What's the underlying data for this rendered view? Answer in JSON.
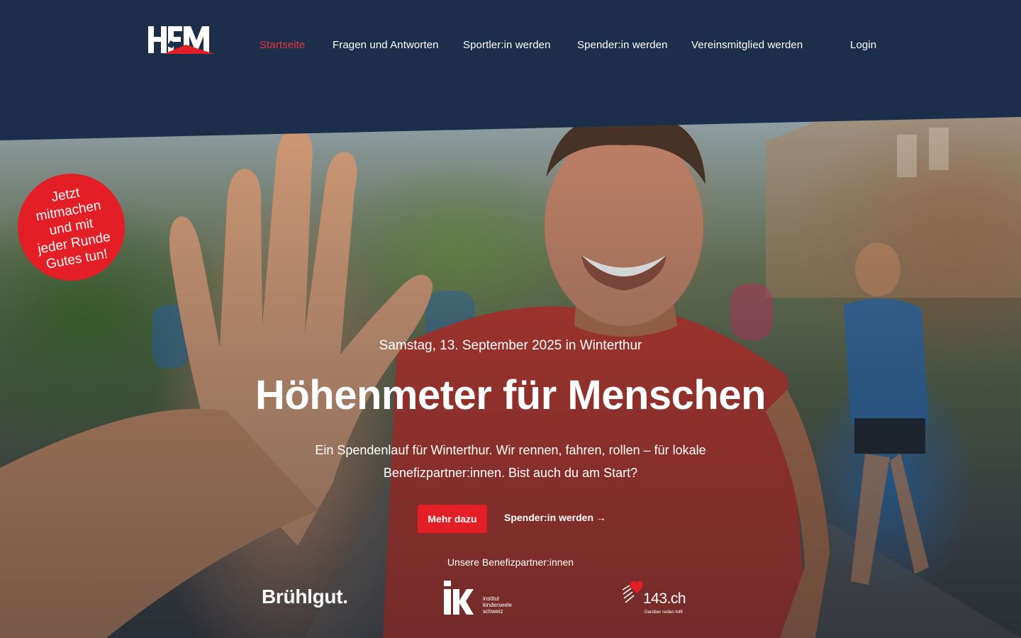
{
  "header": {
    "logo_text": "HfM",
    "nav": [
      {
        "label": "Startseite",
        "active": true
      },
      {
        "label": "Fragen und Antworten",
        "active": false
      },
      {
        "label": "Sportler:in werden",
        "active": false
      },
      {
        "label": "Spender:in werden",
        "active": false
      },
      {
        "label": "Vereinsmitglied werden",
        "active": false
      }
    ],
    "login_label": "Login"
  },
  "badge": {
    "text": "Jetzt\nmitmachen\nund mit\njeder Runde\nGutes tun!"
  },
  "hero": {
    "date": "Samstag, 13. September 2025 in Winterthur",
    "headline": "Höhenmeter für Menschen",
    "lead": "Ein Spendenlauf für Winterthur. Wir rennen, fahren, rollen – für lokale Benefizpartner:innen. Bist auch du am Start?",
    "primary_button": "Mehr dazu",
    "secondary_link": "Spender:in werden →"
  },
  "partners": {
    "label": "Unsere Benefizpartner:innen",
    "bruehlgut": "Brühlgut.",
    "iks": {
      "mark": "iks",
      "text": "institut\nkinderseele\nschweiz"
    },
    "p143": {
      "name": "143.ch",
      "tagline": "Darüber reden hilft"
    }
  },
  "colors": {
    "navy": "#1c2e4a",
    "accent_red": "#e41e26",
    "nav_active": "#e8343d"
  }
}
